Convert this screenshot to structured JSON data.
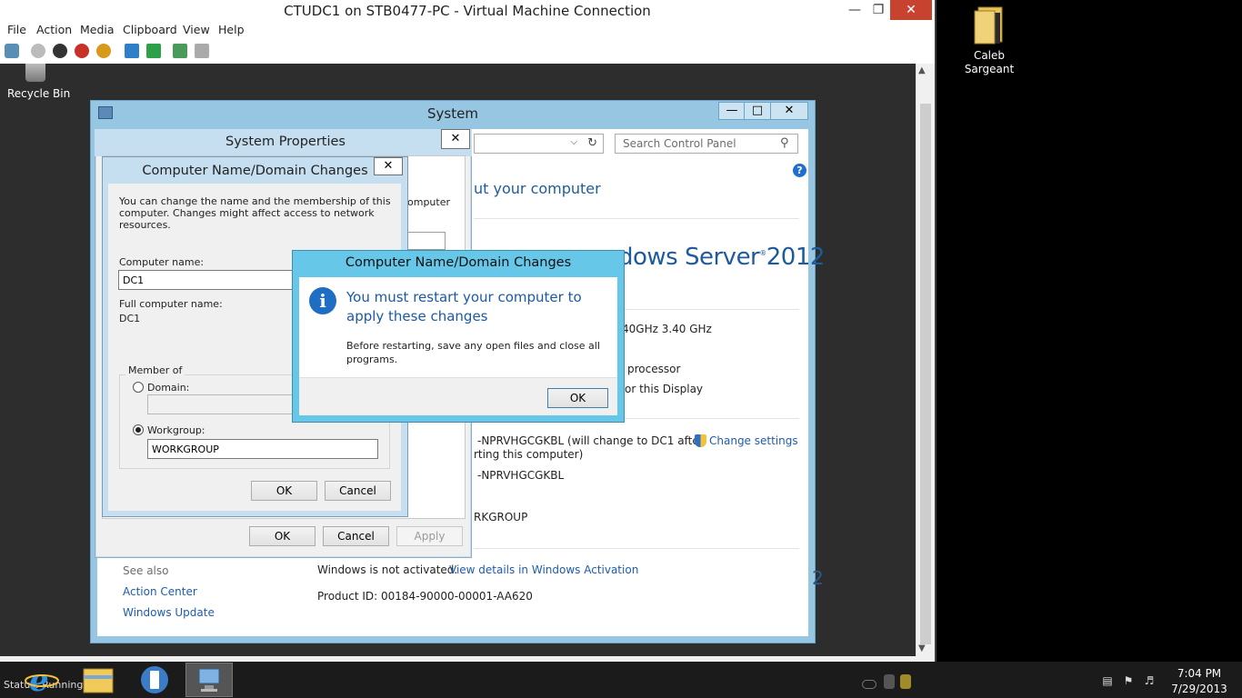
{
  "host": {
    "folder_label": "Caleb Sargeant",
    "clock_time": "7:04 PM",
    "clock_date": "7/29/2013"
  },
  "vm": {
    "title": "CTUDC1 on STB0477-PC - Virtual Machine Connection",
    "menu": [
      "File",
      "Action",
      "Media",
      "Clipboard",
      "View",
      "Help"
    ],
    "status_text": "Status: Running"
  },
  "guest": {
    "recycle_bin": "Recycle Bin",
    "system_window": {
      "title": "System",
      "search_placeholder": "Search Control Panel",
      "heading_partial": "ut your computer",
      "logo_text": "dows Server",
      "logo_version": "2012",
      "processor_speed": "40GHz   3.40 GHz",
      "processor_type": "processor",
      "display_text": "or this Display",
      "computer_name_note": "-NPRVHGCGKBL (will change to DC1 after",
      "computer_name_note2": "rting this computer)",
      "full_name": "-NPRVHGCGKBL",
      "workgroup": "RKGROUP",
      "change_settings": "Change settings",
      "see_also": "See also",
      "action_center": "Action Center",
      "windows_update": "Windows Update",
      "activation_status": "Windows is not activated.",
      "activation_link": "View details in Windows Activation",
      "product_id": "Product ID:  00184-90000-00001-AA620",
      "partial_digit": "2"
    },
    "system_properties": {
      "title": "System Properties",
      "partial_label": "omputer",
      "ok": "OK",
      "cancel": "Cancel",
      "apply": "Apply"
    },
    "computer_name_dialog": {
      "title": "Computer Name/Domain Changes",
      "description": "You can change the name and the membership of this computer. Changes might affect access to network resources.",
      "computer_name_label": "Computer name:",
      "computer_name_value": "DC1",
      "full_name_label": "Full computer name:",
      "full_name_value": "DC1",
      "member_of": "Member of",
      "domain_label": "Domain:",
      "workgroup_label": "Workgroup:",
      "workgroup_value": "WORKGROUP",
      "ok": "OK",
      "cancel": "Cancel"
    },
    "message_box": {
      "title": "Computer Name/Domain Changes",
      "main": "You must restart your computer to apply these changes",
      "sub": "Before restarting, save any open files and close all programs.",
      "ok": "OK"
    }
  },
  "colors": {
    "accent": "#67c7e8",
    "link": "#1e5bb0",
    "close_red": "#c7432f"
  }
}
